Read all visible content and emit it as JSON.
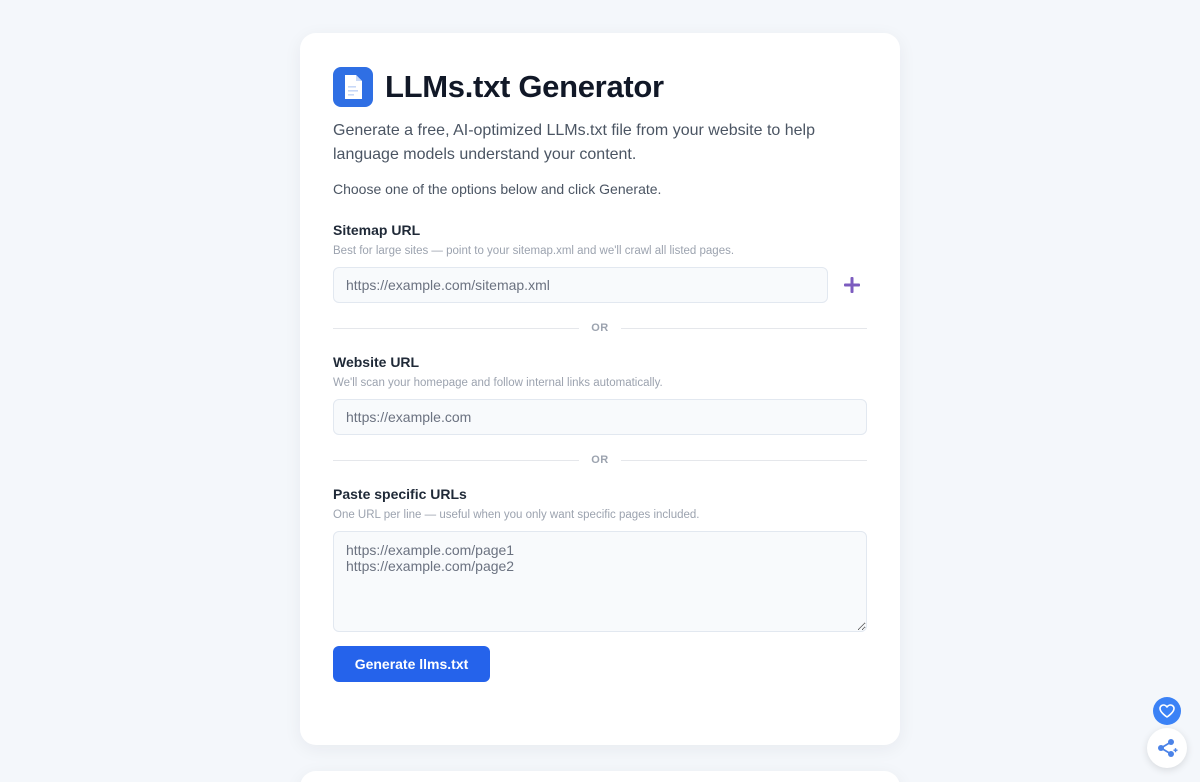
{
  "header": {
    "title": "LLMs.txt Generator",
    "logo_icon": "document-icon",
    "intro": "Generate a free, AI-optimized LLMs.txt file from your website to help language models understand your content.",
    "instructions": "Choose one of the options below and click Generate."
  },
  "sitemap": {
    "label": "Sitemap URL",
    "help": "Best for large sites — point to your sitemap.xml and we'll crawl all listed pages.",
    "placeholder": "https://example.com/sitemap.xml",
    "add_icon": "plus-icon"
  },
  "divider_text": "OR",
  "website": {
    "label": "Website URL",
    "help": "We'll scan your homepage and follow internal links automatically.",
    "placeholder": "https://example.com"
  },
  "urls": {
    "label": "Paste specific URLs",
    "help": "One URL per line — useful when you only want specific pages included.",
    "placeholder": "https://example.com/page1\nhttps://example.com/page2"
  },
  "actions": {
    "generate_label": "Generate llms.txt"
  },
  "floating": {
    "heart_icon": "heart-icon",
    "share_icon": "share-icon"
  },
  "colors": {
    "accent": "#2563eb",
    "logo_bg": "#2f6fe4",
    "plus": "#7c5cbf",
    "page_bg": "#f4f7fb"
  }
}
